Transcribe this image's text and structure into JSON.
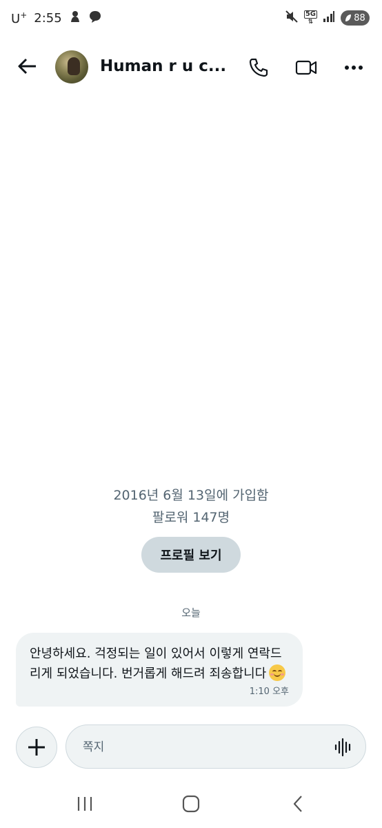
{
  "status_bar": {
    "carrier": "U",
    "carrier_sup": "+",
    "time": "2:55",
    "network": "5G",
    "battery": "88"
  },
  "header": {
    "title": "Human r u c...",
    "icons": [
      "back-arrow-icon",
      "phone-icon",
      "video-camera-icon",
      "more-icon"
    ]
  },
  "profile": {
    "join_date": "2016년 6월 13일에 가입함",
    "followers": "팔로워 147명",
    "view_profile_label": "프로필 보기"
  },
  "conversation": {
    "day_label": "오늘",
    "messages": [
      {
        "text": "안녕하세요. 걱정되는 일이 있어서 이렇게 연락드리게 되었습니다. 번거롭게 해드려 죄송합니다",
        "emoji": "smiling-face-icon",
        "time": "1:10 오후"
      }
    ]
  },
  "composer": {
    "placeholder": "쪽지",
    "add_icon": "plus-icon",
    "voice_icon": "voice-waveform-icon"
  },
  "nav_bar": {
    "icons": [
      "recent-apps-icon",
      "home-icon",
      "back-icon"
    ]
  }
}
